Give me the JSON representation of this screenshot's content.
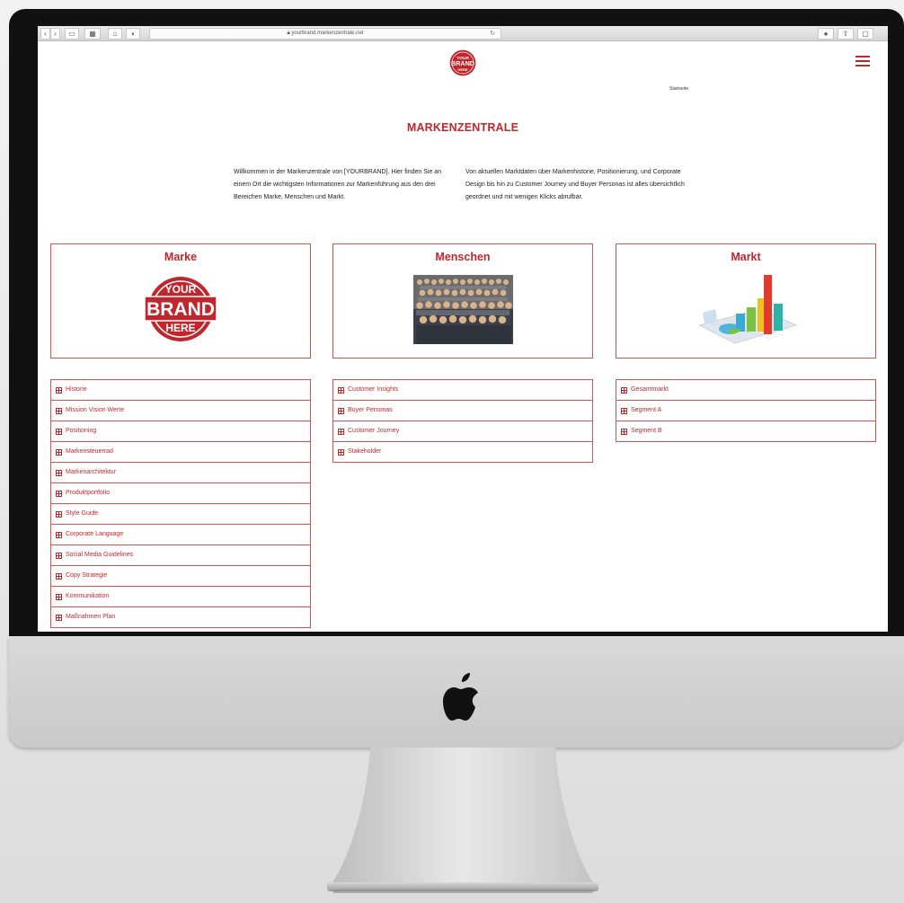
{
  "browser": {
    "url": "yourbrand.markenzentrale.net"
  },
  "header": {
    "logo_lines": [
      "YOUR",
      "BRAND",
      "HERE"
    ],
    "nav_link": "Startseite"
  },
  "main": {
    "title": "MARKENZENTRALE",
    "intro_left": "Willkommen in der Markenzentrale von [YOURBRAND]. Hier finden Sie an einem Ort die wichtigsten Informationen zur Markenführung aus den drei Bereichen Marke, Menschen und Markt.",
    "intro_right": "Von aktuellen Marktdaten über Markenhistorie, Positionierung, und Corporate Design bis hin zu Customer Journey und Buyer Personas ist alles übersichtlich geordnet und mit wenigen Klicks abrufbar."
  },
  "columns": [
    {
      "title": "Marke",
      "items": [
        "Historie",
        "Mission Vision Werte",
        "Positioning",
        "Markensteuerrad",
        "Markenarchitektur",
        "Produktportfolio",
        "Style Guide",
        "Corporate Language",
        "Social Media Guidelines",
        "Copy Strategie",
        "Kommunikation",
        "Maßnahmen Plan"
      ]
    },
    {
      "title": "Menschen",
      "items": [
        "Customer Insights",
        "Buyer Personas",
        "Customer Journey",
        "Stakeholder"
      ]
    },
    {
      "title": "Markt",
      "items": [
        "Gesamtmarkt",
        "Segment A",
        "Segment B"
      ]
    }
  ],
  "colors": {
    "accent": "#c0272d",
    "border": "#d9534f"
  }
}
